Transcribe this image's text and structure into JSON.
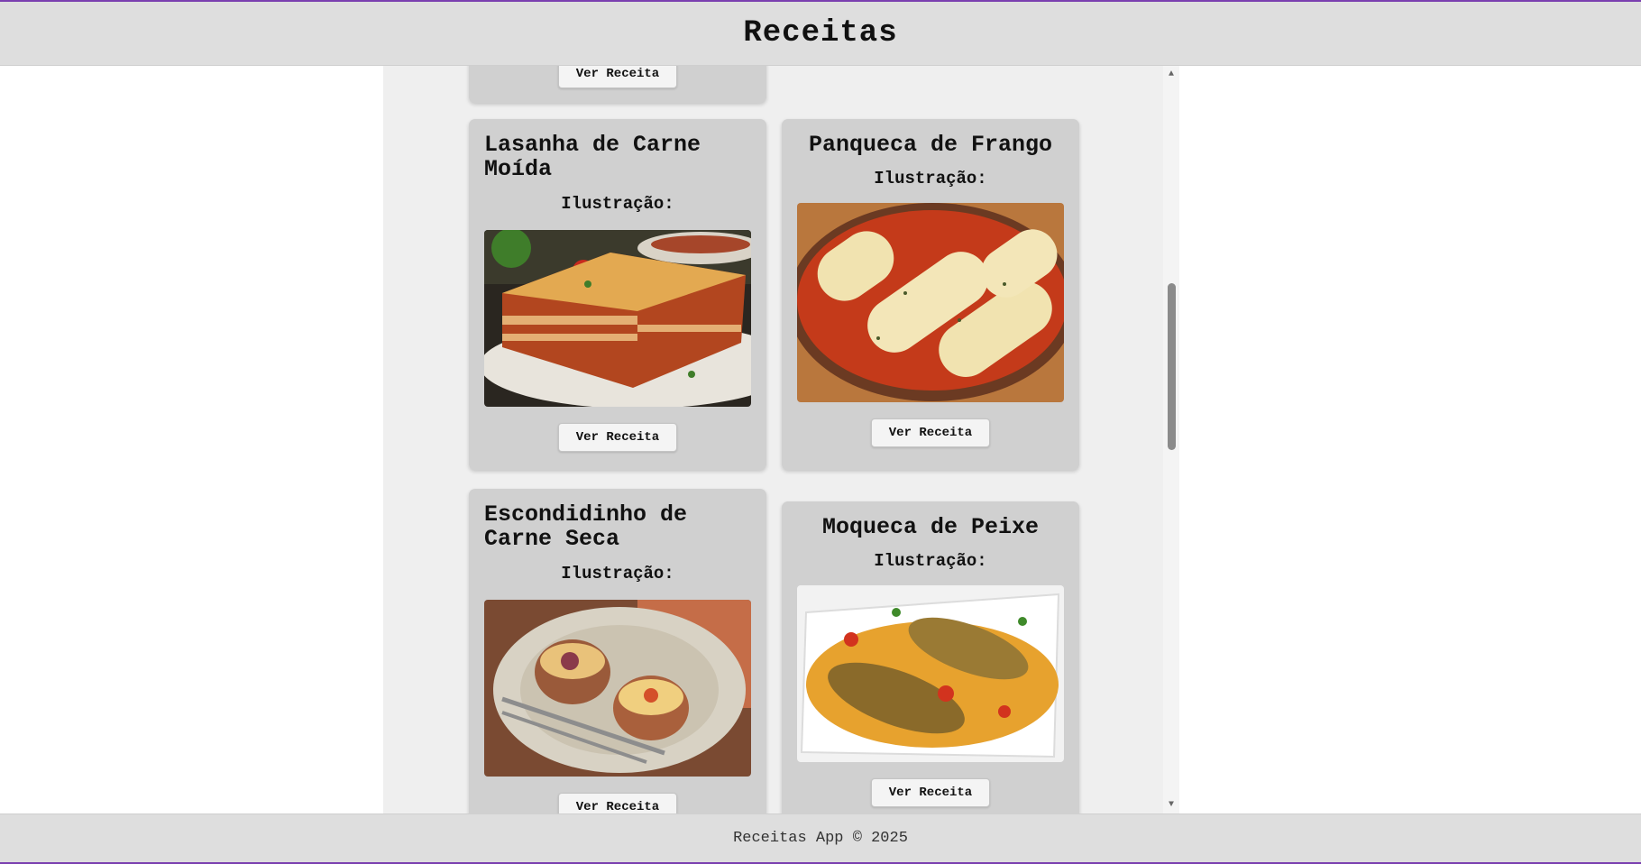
{
  "app": {
    "title": "Receitas"
  },
  "cards": [
    {
      "title": "",
      "subtitle": "",
      "button": "Ver Receita"
    },
    {
      "title": "Lasanha de Carne Moída",
      "subtitle": "Ilustração:",
      "button": "Ver Receita"
    },
    {
      "title": "Panqueca de Frango",
      "subtitle": "Ilustração:",
      "button": "Ver Receita"
    },
    {
      "title": "Escondidinho de Carne Seca",
      "subtitle": "Ilustração:",
      "button": "Ver Receita"
    },
    {
      "title": "Moqueca de Peixe",
      "subtitle": "Ilustração:",
      "button": "Ver Receita"
    }
  ],
  "footer": {
    "text": "Receitas App © 2025"
  },
  "colors": {
    "accent_frame": "#7a3fb0",
    "header_bg": "#dedede",
    "card_bg": "#d0d0d0",
    "panel_bg": "#efefef"
  },
  "icons": {
    "scroll_up": "triangle-up-icon",
    "scroll_down": "triangle-down-icon"
  }
}
